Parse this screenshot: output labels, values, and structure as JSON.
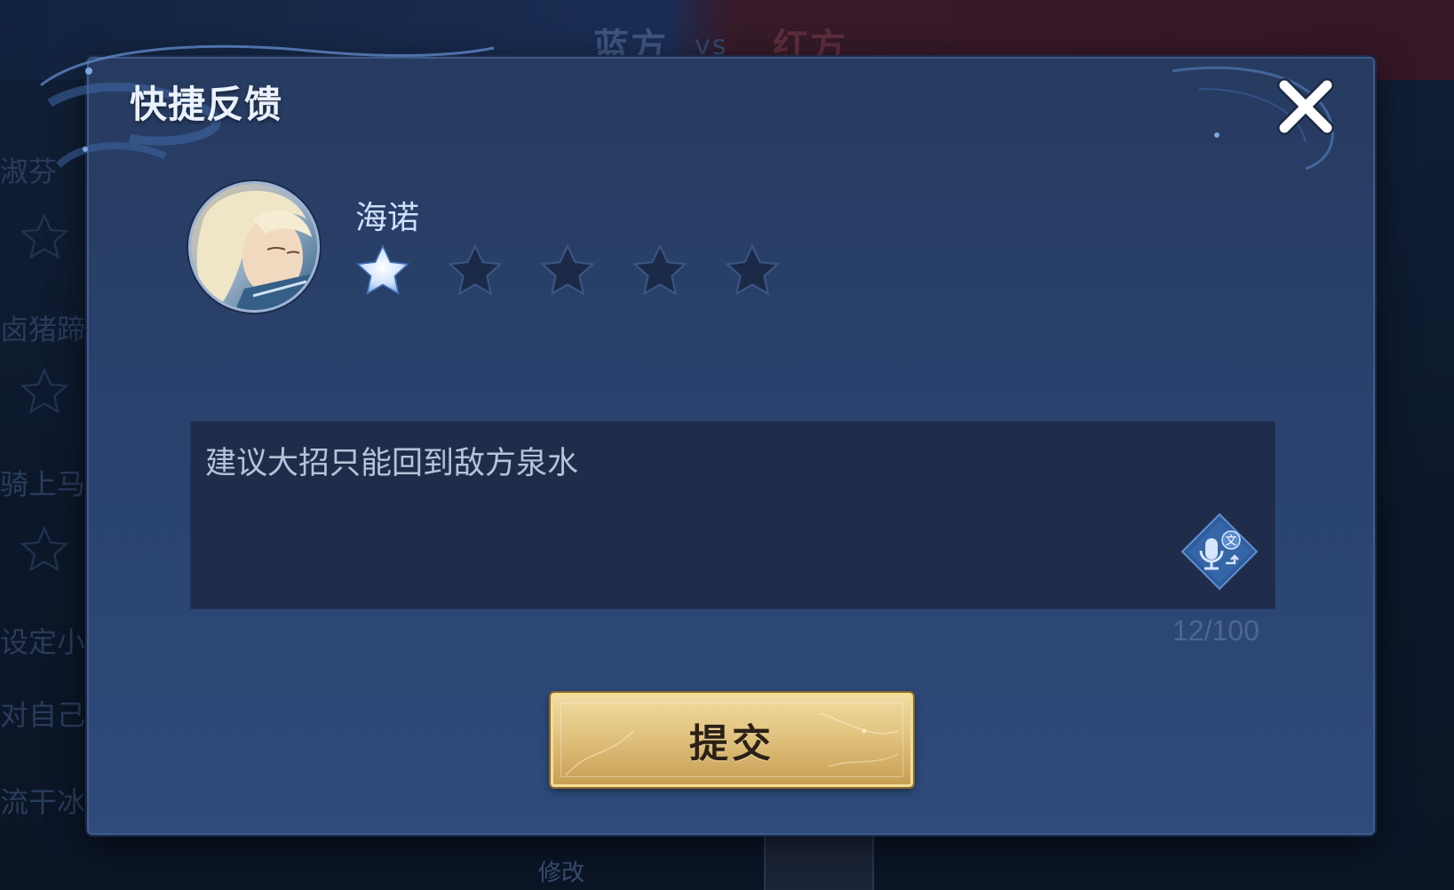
{
  "background": {
    "teams": {
      "blue": "蓝方",
      "vs": "vs",
      "red": "红方"
    },
    "left_items": [
      "淑芬",
      "卤猪蹄",
      "骑上马",
      "设定小",
      "对自己",
      "流干冰"
    ],
    "bottom_label": "修改"
  },
  "modal": {
    "title": "快捷反馈",
    "close_icon": "close-icon",
    "hero": {
      "name": "海诺",
      "rating": {
        "value": 1,
        "max": 5
      }
    },
    "feedback": {
      "text": "建议大招只能回到敌方泉水",
      "char_count": "12/100",
      "voice_icon": "mic-translate-icon"
    },
    "submit": {
      "label": "提交"
    }
  },
  "colors": {
    "modal_bg": "#2a4370",
    "title_text": "#eaf1ff",
    "star_active": "#cfe3ff",
    "star_inactive": "#1b2a46",
    "input_bg": "#1f2d4a",
    "button_gold": "#e3c683"
  }
}
